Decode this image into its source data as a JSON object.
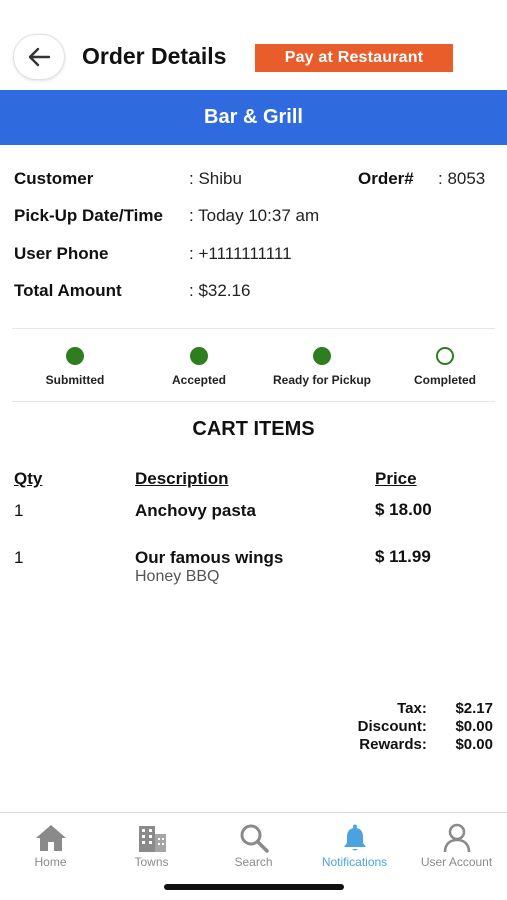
{
  "header": {
    "title": "Order Details",
    "payment_badge": "Pay at Restaurant",
    "back_icon": "arrow-left-icon"
  },
  "restaurant": {
    "name": "Bar & Grill",
    "color": "#2f6bde"
  },
  "order_info": {
    "customer_label": "Customer",
    "customer_value": ": Shibu",
    "order_label": "Order#",
    "order_value": ": 8053",
    "pickup_label": "Pick-Up Date/Time",
    "pickup_value": ": Today 10:37 am",
    "phone_label": "User Phone",
    "phone_value": ": +1111111111",
    "total_label": "Total Amount",
    "total_value": ": $32.16"
  },
  "status": {
    "active_color": "#2e7d1f",
    "steps": [
      {
        "label": "Submitted",
        "done": true
      },
      {
        "label": "Accepted",
        "done": true
      },
      {
        "label": "Ready for Pickup",
        "done": true
      },
      {
        "label": "Completed",
        "done": false
      }
    ]
  },
  "cart": {
    "title": "CART ITEMS",
    "columns": {
      "qty": "Qty",
      "description": "Description",
      "price": "Price"
    },
    "items": [
      {
        "qty": "1",
        "name": "Anchovy pasta",
        "note": "",
        "price": "$ 18.00"
      },
      {
        "qty": "1",
        "name": "Our famous wings",
        "note": "Honey BBQ",
        "price": "$ 11.99"
      }
    ]
  },
  "totals": {
    "tax_label": "Tax:",
    "tax_value": "$2.17",
    "discount_label": "Discount:",
    "discount_value": "$0.00",
    "rewards_label": "Rewards:",
    "rewards_value": "$0.00"
  },
  "tabbar": {
    "active_color": "#4aa3e0",
    "items": [
      {
        "label": "Home",
        "icon": "home-icon"
      },
      {
        "label": "Towns",
        "icon": "buildings-icon"
      },
      {
        "label": "Search",
        "icon": "search-icon"
      },
      {
        "label": "Notifications",
        "icon": "bell-icon"
      },
      {
        "label": "User Account",
        "icon": "user-icon"
      }
    ]
  }
}
